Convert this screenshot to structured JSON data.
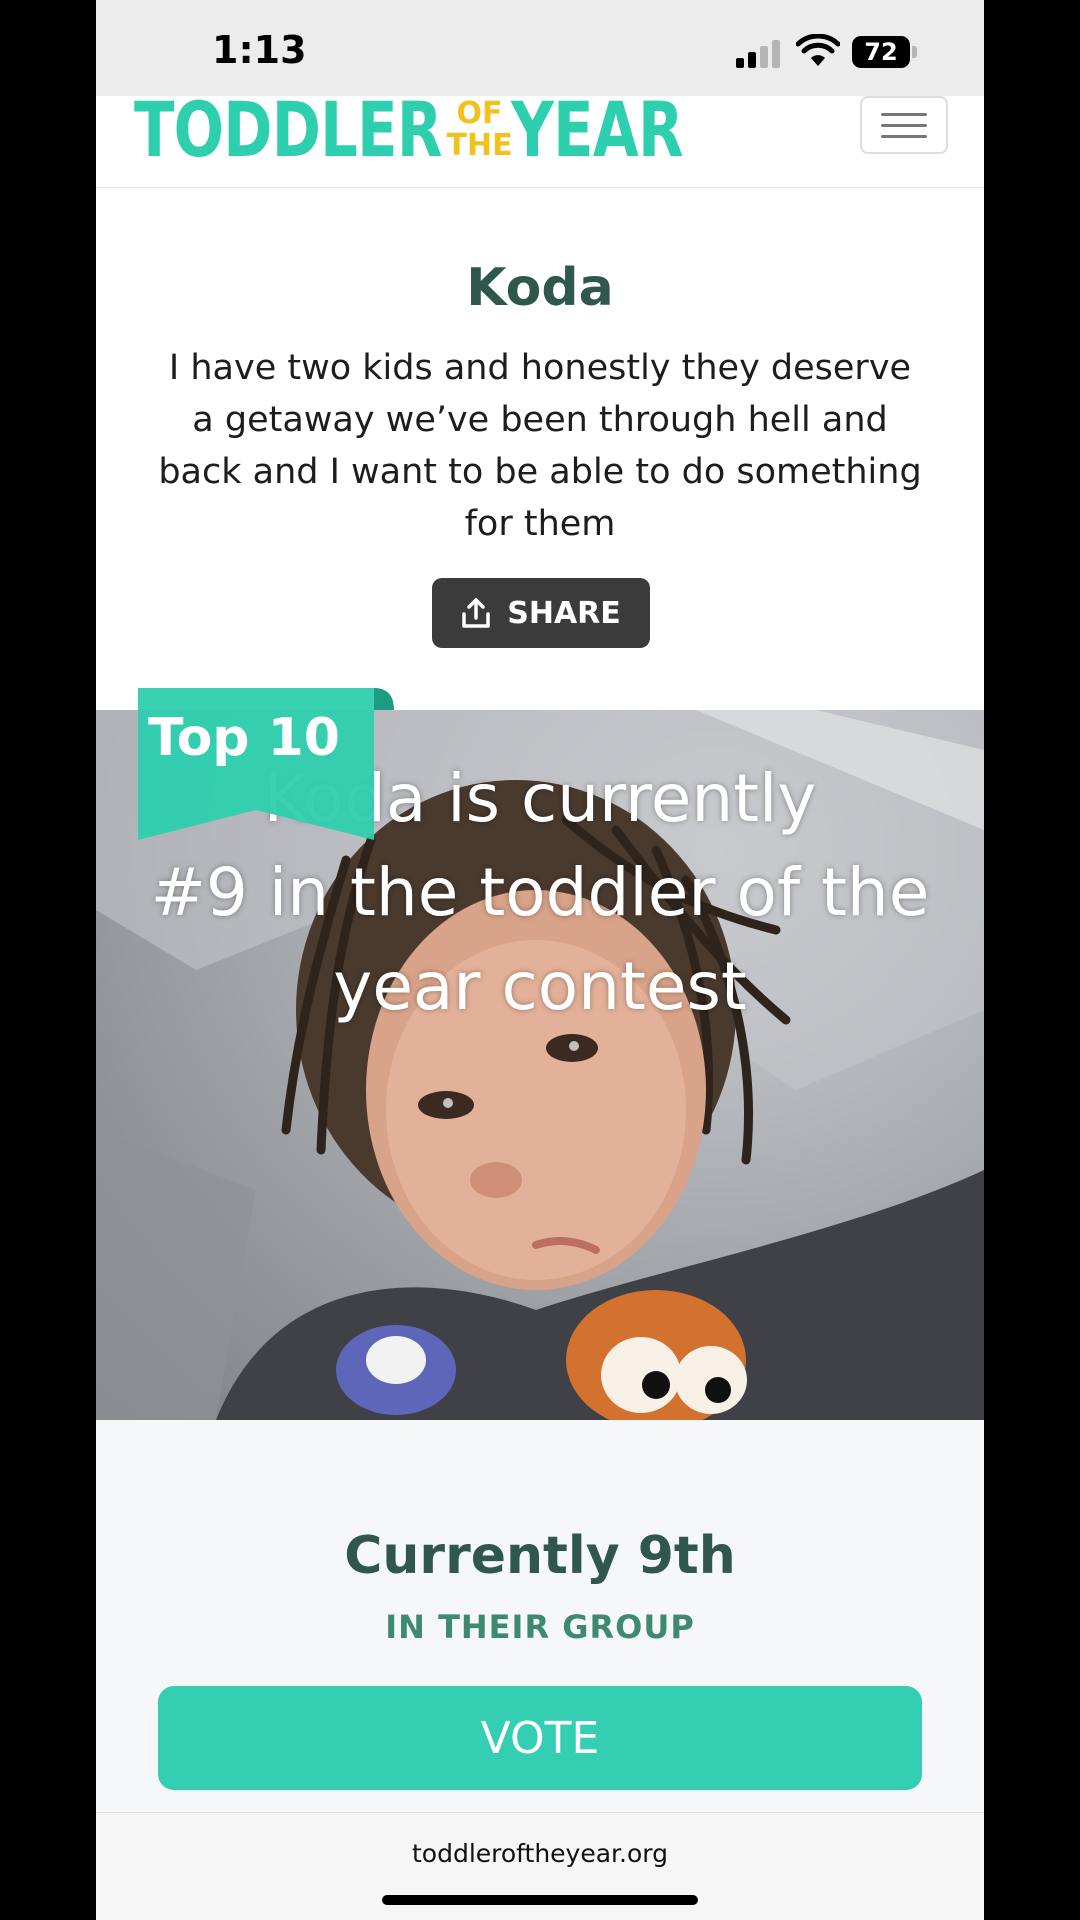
{
  "status_bar": {
    "time": "1:13",
    "battery": "72"
  },
  "header": {
    "logo": {
      "left": "TODDLER",
      "mid_top": "OF",
      "mid_bottom": "THE",
      "right": "YEAR"
    },
    "menu_icon": "hamburger-icon"
  },
  "profile": {
    "name": "Koda",
    "bio": "I have two kids and honestly they deserve a getaway we’ve been through hell and back and I want to be able to do something for them",
    "share_label": "SHARE",
    "share_icon": "upload-icon"
  },
  "photo": {
    "badge": "Top 10",
    "overlay_line1": "Koda is currently",
    "overlay_line2": "#9 in the toddler of the",
    "overlay_line3": "year contest"
  },
  "rank": {
    "title": "Currently 9th",
    "subtitle": "IN THEIR GROUP",
    "vote_label": "VOTE"
  },
  "browser": {
    "url": "toddleroftheyear.org"
  },
  "colors": {
    "brand_teal": "#2ecfae",
    "brand_yellow": "#f2c11d",
    "heading_green": "#2f574c",
    "vote_button": "#34cfb3"
  }
}
